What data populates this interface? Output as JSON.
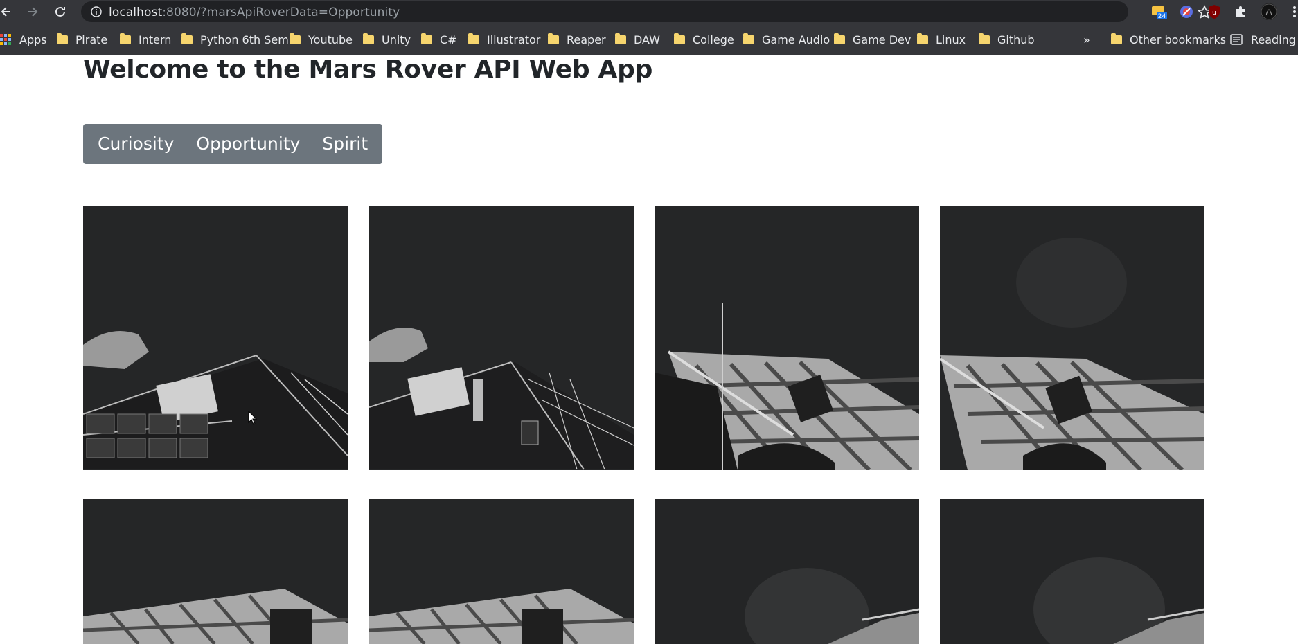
{
  "browser": {
    "url_host": "localhost",
    "url_rest": ":8080/?marsApiRoverData=Opportunity",
    "extension_badge": "24"
  },
  "bookmarks": [
    {
      "label": "Apps"
    },
    {
      "label": "Pirate"
    },
    {
      "label": "Intern"
    },
    {
      "label": "Python 6th Sem"
    },
    {
      "label": "Youtube"
    },
    {
      "label": "Unity"
    },
    {
      "label": "C#"
    },
    {
      "label": "Illustrator"
    },
    {
      "label": "Reaper"
    },
    {
      "label": "DAW"
    },
    {
      "label": "College"
    },
    {
      "label": "Game Audio"
    },
    {
      "label": "Game Dev"
    },
    {
      "label": "Linux"
    },
    {
      "label": "Github"
    }
  ],
  "bookmarks_overflow": "»",
  "other_bookmarks": "Other bookmarks",
  "reading_list": "Reading lis",
  "page": {
    "title": "Welcome to the Mars Rover API Web App",
    "rovers": [
      "Curiosity",
      "Opportunity",
      "Spirit"
    ]
  },
  "photos": [
    "rover-photo",
    "rover-photo",
    "rover-photo",
    "rover-photo",
    "rover-photo",
    "rover-photo",
    "rover-photo",
    "rover-photo"
  ],
  "colors": {
    "button_group": "#6c757d",
    "chrome_bg": "#35363a",
    "omnibox_bg": "#202124"
  }
}
